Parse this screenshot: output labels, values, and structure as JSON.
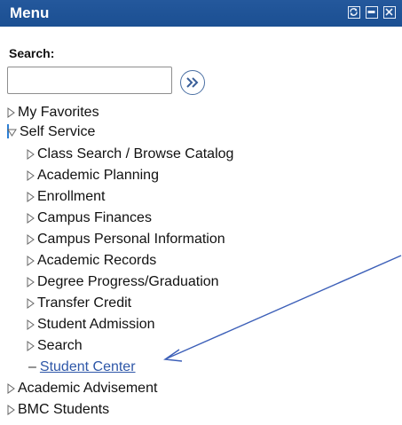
{
  "window": {
    "title": "Menu",
    "controls": [
      "refresh-icon",
      "minimize-icon",
      "close-icon"
    ]
  },
  "search": {
    "label": "Search:",
    "value": "",
    "go_icon": "double-chevron-right-icon"
  },
  "menu": {
    "my_favorites": "My Favorites",
    "self_service": "Self Service",
    "children": [
      "Class Search / Browse Catalog",
      "Academic Planning",
      "Enrollment",
      "Campus Finances",
      "Campus Personal Information",
      "Academic Records",
      "Degree Progress/Graduation",
      "Transfer Credit",
      "Student Admission",
      "Search"
    ],
    "student_center": "Student Center",
    "academic_advisement": "Academic Advisement",
    "bmc_students": "BMC Students"
  },
  "colors": {
    "title_bar": "#1f5396",
    "link": "#2e57a8",
    "arrow": "#3c5fb8"
  }
}
